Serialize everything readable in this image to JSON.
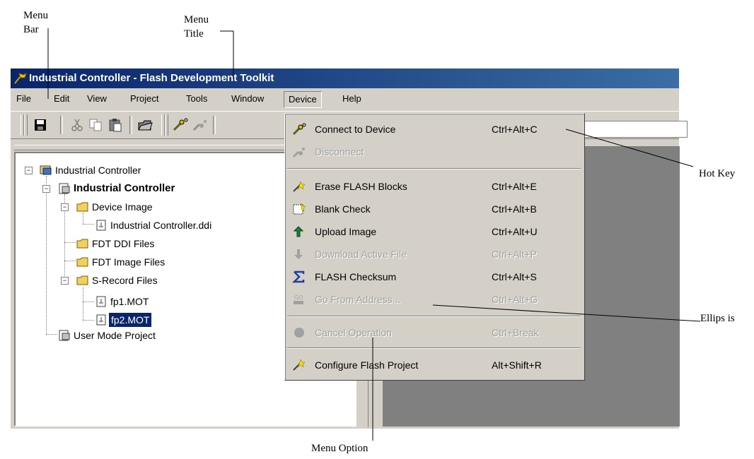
{
  "annotations": {
    "menu_bar_line1": "Menu",
    "menu_bar_line2": "Bar",
    "menu_title_line1": "Menu",
    "menu_title_line2": "Title",
    "hot_key": "Hot Key",
    "ellipsis": "Ellips is",
    "menu_option": "Menu Option"
  },
  "window": {
    "title": "Industrial Controller - Flash Development Toolkit"
  },
  "menubar": {
    "items": [
      "File",
      "Edit",
      "View",
      "Project",
      "Tools",
      "Window",
      "Device",
      "Help"
    ],
    "active": "Device"
  },
  "tree": {
    "nodes": [
      {
        "label": "Industrial Controller",
        "icon": "workspace-icon"
      },
      {
        "label": "Industrial Controller",
        "icon": "project-icon",
        "bold": true
      },
      {
        "label": "Device Image",
        "icon": "folder-icon"
      },
      {
        "label": "Industrial Controller.ddi",
        "icon": "file-icon"
      },
      {
        "label": "FDT DDI Files",
        "icon": "folder-icon"
      },
      {
        "label": "FDT Image Files",
        "icon": "folder-icon"
      },
      {
        "label": "S-Record Files",
        "icon": "folder-icon"
      },
      {
        "label": "fp1.MOT",
        "icon": "file-icon"
      },
      {
        "label": "fp2.MOT",
        "icon": "file-icon",
        "selected": true
      },
      {
        "label": "User Mode Project",
        "icon": "project-icon"
      }
    ]
  },
  "device_menu": {
    "items": [
      {
        "label": "Connect to Device",
        "shortcut": "Ctrl+Alt+C",
        "enabled": true,
        "icon": "connect-icon"
      },
      {
        "label": "Disconnect",
        "shortcut": "",
        "enabled": false,
        "icon": "disconnect-icon"
      },
      {
        "label": "Erase FLASH Blocks",
        "shortcut": "Ctrl+Alt+E",
        "enabled": true,
        "icon": "erase-icon"
      },
      {
        "label": "Blank Check",
        "shortcut": "Ctrl+Alt+B",
        "enabled": true,
        "icon": "blank-check-icon"
      },
      {
        "label": "Upload Image",
        "shortcut": "Ctrl+Alt+U",
        "enabled": true,
        "icon": "upload-icon"
      },
      {
        "label": "Download Active File",
        "shortcut": "Ctrl+Alt+P",
        "enabled": false,
        "icon": "download-icon"
      },
      {
        "label": "FLASH Checksum",
        "shortcut": "Ctrl+Alt+S",
        "enabled": true,
        "icon": "sigma-icon"
      },
      {
        "label": "Go From Address...",
        "shortcut": "Ctrl+Alt+G",
        "enabled": false,
        "icon": "go-icon"
      },
      {
        "label": "Cancel Operation",
        "shortcut": "Ctrl+Break",
        "enabled": false,
        "icon": "cancel-icon"
      },
      {
        "label": "Configure Flash Project",
        "shortcut": "Alt+Shift+R",
        "enabled": true,
        "icon": "configure-icon"
      }
    ]
  },
  "colors": {
    "title_bar_start": "#0a246a",
    "title_bar_end": "#3a6ea5",
    "face": "#d4d0c8",
    "selection": "#0a246a",
    "client_gray": "#808080"
  }
}
